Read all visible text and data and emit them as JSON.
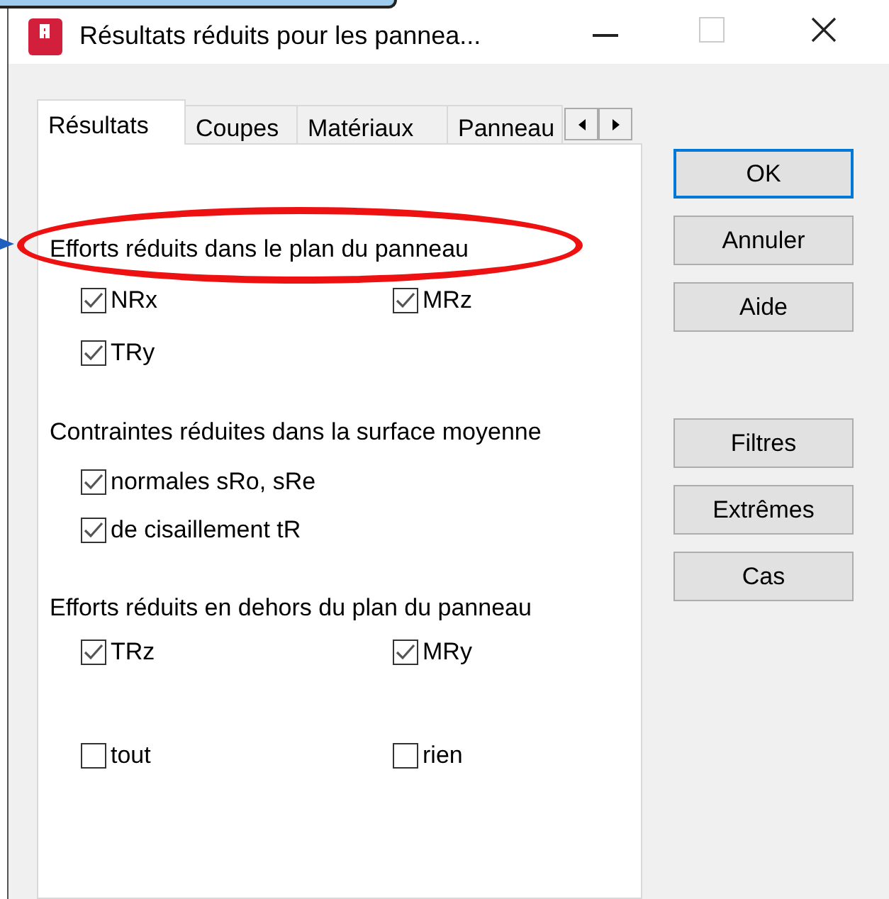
{
  "window": {
    "title": "Résultats réduits pour les pannea..."
  },
  "tabs": [
    {
      "label": "Résultats",
      "selected": true
    },
    {
      "label": "Coupes",
      "selected": false
    },
    {
      "label": "Matériaux",
      "selected": false
    },
    {
      "label": "Panneau",
      "selected": false
    }
  ],
  "sections": [
    {
      "heading": "Efforts réduits dans le plan du panneau",
      "highlighted": true,
      "rows": [
        [
          {
            "label": "NRx",
            "checked": true
          },
          {
            "label": "MRz",
            "checked": true
          }
        ],
        [
          {
            "label": "TRy",
            "checked": true
          }
        ]
      ]
    },
    {
      "heading": "Contraintes réduites dans la surface moyenne",
      "highlighted": false,
      "rows": [
        [
          {
            "label": "normales sRo, sRe",
            "checked": true
          }
        ],
        [
          {
            "label": "de cisaillement tR",
            "checked": true
          }
        ]
      ]
    },
    {
      "heading": "Efforts réduits en dehors du plan du panneau",
      "highlighted": false,
      "rows": [
        [
          {
            "label": "TRz",
            "checked": true
          },
          {
            "label": "MRy",
            "checked": true
          }
        ]
      ]
    }
  ],
  "select_options": [
    {
      "label": "tout",
      "checked": false
    },
    {
      "label": "rien",
      "checked": false
    }
  ],
  "button_groups": [
    [
      {
        "label": "OK",
        "default": true
      },
      {
        "label": "Annuler",
        "default": false
      },
      {
        "label": "Aide",
        "default": false
      }
    ],
    [
      {
        "label": "Filtres",
        "default": false
      },
      {
        "label": "Extrêmes",
        "default": false
      },
      {
        "label": "Cas",
        "default": false
      }
    ]
  ]
}
